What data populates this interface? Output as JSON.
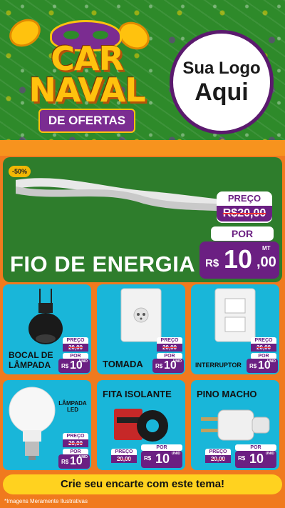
{
  "header": {
    "title_line1": "CAR",
    "title_line2": "NAVAL",
    "ribbon": "DE OFERTAS",
    "logo_line1": "Sua Logo",
    "logo_line2": "Aqui"
  },
  "featured": {
    "discount": "-50%",
    "title": "FIO DE ENERGIA",
    "preco_label": "PREÇO",
    "old_currency": "R$",
    "old_price": "20,00",
    "por_label": "POR",
    "currency": "R$",
    "price_int": "10",
    "price_cents": ",00",
    "unit": "MT"
  },
  "products": [
    {
      "name": "BOCAL DE LÂMPADA",
      "preco": "PREÇO",
      "old": "20,00",
      "por": "POR",
      "cur": "R$",
      "int": "10",
      "cents": ",00",
      "unit": "UNID"
    },
    {
      "name": "TOMADA",
      "preco": "PREÇO",
      "old": "20,00",
      "por": "POR",
      "cur": "R$",
      "int": "10",
      "cents": ",00",
      "unit": "UNID"
    },
    {
      "name": "INTERRUPTOR",
      "preco": "PREÇO",
      "old": "20,00",
      "por": "POR",
      "cur": "R$",
      "int": "10",
      "cents": ",00",
      "unit": "UNID"
    },
    {
      "name": "LÂMPADA LED",
      "preco": "PREÇO",
      "old": "20,00",
      "por": "POR",
      "cur": "R$",
      "int": "10",
      "cents": ",00",
      "unit": "UNID"
    },
    {
      "name": "FITA ISOLANTE",
      "preco": "PREÇO",
      "old": "20,00",
      "por": "POR",
      "cur": "R$",
      "int": "10",
      "cents": ",00",
      "unit": "UNID"
    },
    {
      "name": "PINO MACHO",
      "preco": "PREÇO",
      "old": "20,00",
      "por": "POR",
      "cur": "R$",
      "int": "10",
      "cents": ",00",
      "unit": "UNID"
    }
  ],
  "footer": {
    "banner": "Crie seu encarte com este tema!",
    "disclaimer": "*Imagens Meramente Ilustrativas"
  },
  "colors": {
    "green": "#2e7d2c",
    "purple": "#6b1f82",
    "cyan": "#19b6d9",
    "orange": "#f07a1e",
    "yellow": "#ffd21f"
  }
}
